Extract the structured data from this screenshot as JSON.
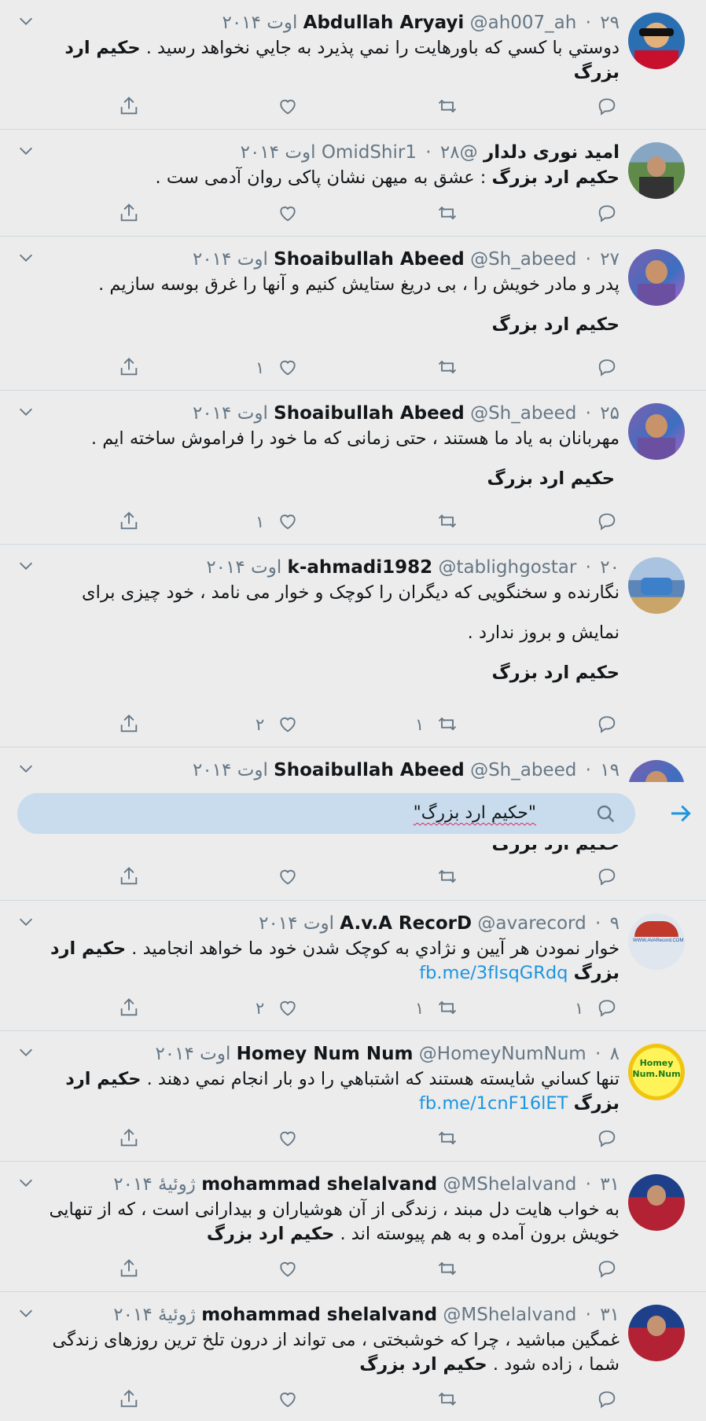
{
  "search": {
    "query": "\"حکیم ارد بزرگ\""
  },
  "colors": {
    "accent": "#1b95e0",
    "background": "#ececec",
    "search_bg": "#c8dced",
    "secondary_text": "#657786"
  },
  "tweets": [
    {
      "name": "Abdullah Aryayi",
      "handle": "@ah007_ah",
      "date": "۲۹ اوت ۲۰۱۴",
      "dot": "·",
      "text_plain": "دوستي با کسي که باورهايت را نمي پذيرد به جايي نخواهد رسيد . ",
      "text_bold": "حکیم ارد بزرگ",
      "reply_count": "",
      "retweet_count": "",
      "like_count": ""
    },
    {
      "name": "امید نوری دلدار",
      "handle": "@OmidShir1",
      "date": "۲۸ اوت ۲۰۱۴",
      "dot": "·",
      "text_bold": "حکیم ارد بزرگ",
      "text_plain": " : عشق به میهن نشان پاکی روان آدمی ست ."
    },
    {
      "name": "Shoaibullah Abeed",
      "handle": "@Sh_abeed",
      "date": "۲۷ اوت ۲۰۱۴",
      "dot": "·",
      "text_plain": "پدر و مادر خویش را ، بی دریغ ستایش کنیم و آنها را غرق بوسه سازیم .",
      "text_bold": "حکیم ارد بزرگ",
      "like_count": "۱"
    },
    {
      "name": "Shoaibullah Abeed",
      "handle": "@Sh_abeed",
      "date": "۲۵ اوت ۲۰۱۴",
      "dot": "·",
      "text_plain": "مهربانان به یاد ما هستند ، حتی زمانی که ما خود را فراموش ساخته ایم .",
      "text_bold": "حکیم ارد بزرگ",
      "like_count": "۱"
    },
    {
      "name": "k-ahmadi1982",
      "handle": "@tablighgostar",
      "date": "۲۰ اوت ۲۰۱۴",
      "dot": "·",
      "text_line1": "نگارنده و سخنگویی که دیگران را کوچک و خوار می نامد ، خود چیزی برای",
      "text_line2": "نمایش و بروز ندارد .",
      "text_bold": "حکیم ارد بزرگ",
      "retweet_count": "۱",
      "like_count": "۲"
    },
    {
      "name": "Shoaibullah Abeed",
      "handle": "@Sh_abeed",
      "date": "۱۹ اوت ۲۰۱۴",
      "dot": "·",
      "text_bold": "حکیم ارد بزرگ"
    },
    {
      "name": "A.v.A RecorD",
      "handle": "@avarecord",
      "date": "۹ اوت ۲۰۱۴",
      "dot": "·",
      "text_plain": "خوار نمودن هر آيين و نژادي به کوچک شدن خود ما خواهد انجاميد . ",
      "text_bold": "حکیم ارد بزرگ",
      "link": "fb.me/3fIsqGRdq",
      "reply_count": "۱",
      "retweet_count": "۱",
      "like_count": "۲",
      "avatar_text": "WWW.AVARecord.COM"
    },
    {
      "name": "Homey Num Num",
      "handle": "@HomeyNumNum",
      "date": "۸ اوت ۲۰۱۴",
      "dot": "·",
      "text_plain": "تنها کساني شايسته هستند که اشتباهي را دو بار انجام نمي دهند . ",
      "text_bold": "حکیم ارد بزرگ",
      "link": "fb.me/1cnF16lET",
      "avatar_line1": "Homey",
      "avatar_line2": "Num.Num"
    },
    {
      "name": "mohammad shelalvand",
      "handle": "@MShelalvand",
      "date": "۳۱ ژوئیهٔ ۲۰۱۴",
      "dot": "·",
      "text_line1": "به خواب هایت دل مبند ، زندگی از آن هوشیاران و بیدارانی است ، که از تنهایی",
      "text_line2": "خویش برون آمده و به هم پیوسته اند . ",
      "text_bold": "حکیم ارد بزرگ"
    },
    {
      "name": "mohammad shelalvand",
      "handle": "@MShelalvand",
      "date": "۳۱ ژوئیهٔ ۲۰۱۴",
      "dot": "·",
      "text_line1": "غمگین مباشید ، چرا که خوشبختی ، می تواند از درون تلخ ترین روزهای زندگی",
      "text_line2": "شما ، زاده شود . ",
      "text_bold": "حکیم ارد بزرگ"
    }
  ]
}
